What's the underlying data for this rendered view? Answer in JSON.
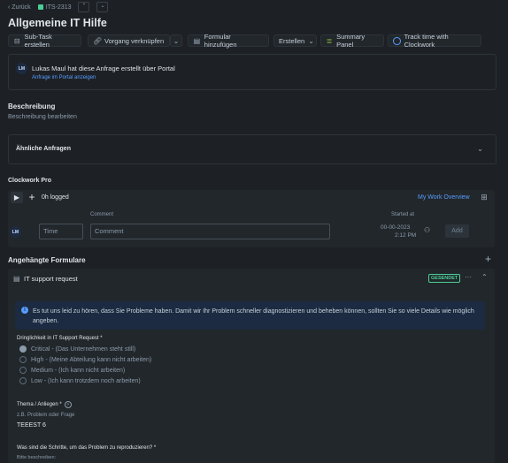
{
  "breadcrumb": {
    "back": "Zurück",
    "issue_key": "ITS-2313"
  },
  "page_title": "Allgemeine IT Hilfe",
  "toolbar": {
    "subtask": "Sub-Task erstellen",
    "link_issue": "Vorgang verknüpfen",
    "add_form": "Formular hinzufügen",
    "create": "Erstellen",
    "summary_panel": "Summary Panel",
    "track_time": "Track time with Clockwork"
  },
  "requester": {
    "avatar": "LM",
    "text": "Lukas Maul hat diese Anfrage erstellt über Portal",
    "portal_link": "Anfrage im Portal anzeigen"
  },
  "description": {
    "title": "Beschreibung",
    "placeholder": "Beschreibung bearbeiten"
  },
  "similar": {
    "title": "Ähnliche Anfragen"
  },
  "clockwork": {
    "title": "Clockwork Pro",
    "logged": "0h logged",
    "overview_link": "My Work Overview",
    "comment_header": "Comment",
    "started_header": "Started at",
    "avatar": "LM",
    "time_placeholder": "Time",
    "comment_placeholder": "Comment",
    "date": "00-00-2023",
    "time": "2:12 PM",
    "add_button": "Add"
  },
  "forms": {
    "title": "Angehängte Formulare",
    "form_title": "IT support request",
    "status_badge": "GESENDET",
    "info_text": "Es tut uns leid zu hören, dass Sie Probleme haben. Damit wir Ihr Problem schneller diagnostizieren und beheben können, sollten Sie so viele Details wie möglich angeben.",
    "urgency_label": "Dringlichkeit in IT Support Request *",
    "urgency_options": [
      "Critical - (Das Unternehmen steht still)",
      "High - (Meine Abteilung kann nicht arbeiten)",
      "Medium - (Ich kann nicht arbeiten)",
      "Low - (Ich kann trotzdem noch arbeiten)"
    ],
    "urgency_selected_index": 0,
    "topic_label": "Thema / Anliegen *",
    "topic_hint": "z.B. Problem oder Frage",
    "topic_value": "TEEEST 6",
    "steps_label": "Was sind die Schritte, um das Problem zu reproduzieren? *",
    "steps_hint": "Bitte beschreiben:"
  }
}
